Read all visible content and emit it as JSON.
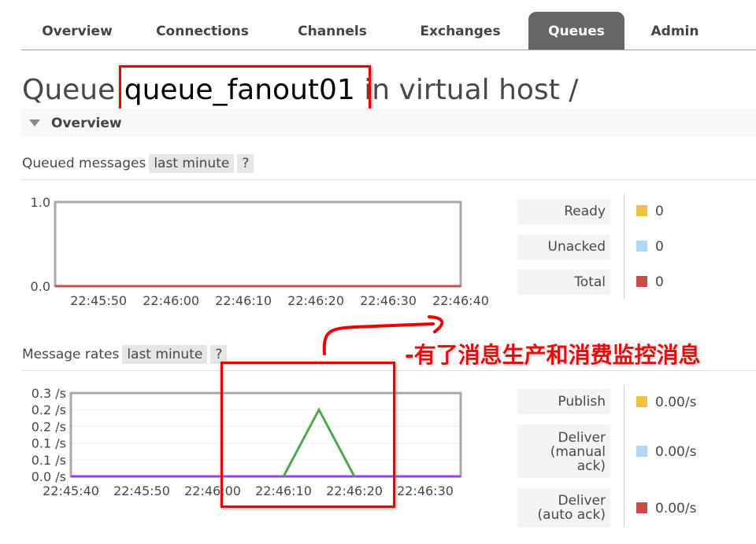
{
  "tabs": [
    {
      "label": "Overview"
    },
    {
      "label": "Connections"
    },
    {
      "label": "Channels"
    },
    {
      "label": "Exchanges"
    },
    {
      "label": "Queues",
      "active": true
    },
    {
      "label": "Admin"
    }
  ],
  "title": {
    "prefix": "Queue",
    "name": "queue_fanout01",
    "suffix": "in virtual host /"
  },
  "section": "Overview",
  "queued": {
    "label": "Queued messages",
    "range": "last minute",
    "help": "?",
    "legend": [
      {
        "label": "Ready",
        "value": "0",
        "color": "#edc240"
      },
      {
        "label": "Unacked",
        "value": "0",
        "color": "#afd8f8"
      },
      {
        "label": "Total",
        "value": "0",
        "color": "#cb4b4b"
      }
    ]
  },
  "rates": {
    "label": "Message rates",
    "range": "last minute",
    "help": "?",
    "legend": [
      {
        "label": "Publish",
        "value": "0.00/s",
        "color": "#edc240"
      },
      {
        "label": "Deliver (manual ack)",
        "value": "0.00/s",
        "color": "#afd8f8"
      },
      {
        "label": "Deliver (auto ack)",
        "value": "0.00/s",
        "color": "#cb4b4b"
      }
    ]
  },
  "annotation": "-有了消息生产和消费监控消息",
  "colors": {
    "annotation": "#e01010",
    "green": "#4da74d",
    "purple": "#9440ed"
  },
  "chart_data": [
    {
      "type": "line",
      "title": "Queued messages",
      "xlim": [
        "22:45:44",
        "22:46:40"
      ],
      "ylim": [
        0,
        1
      ],
      "xticks": [
        "22:45:50",
        "22:46:00",
        "22:46:10",
        "22:46:20",
        "22:46:30",
        "22:46:40"
      ],
      "yticks": [
        "0.0",
        "1.0"
      ],
      "ytick_values": [
        0,
        1
      ],
      "series": [
        {
          "color": "#cb4b4b",
          "x": [
            "22:45:44",
            "22:46:40"
          ],
          "y": [
            0,
            0
          ]
        }
      ]
    },
    {
      "type": "line",
      "title": "Message rates",
      "xlim": [
        "22:45:40",
        "22:46:35"
      ],
      "ylim": [
        0,
        0.25
      ],
      "xticks": [
        "22:45:40",
        "22:45:50",
        "22:46:00",
        "22:46:10",
        "22:46:20",
        "22:46:30"
      ],
      "yticks": [
        "0.0 /s",
        "0.1 /s",
        "0.1 /s",
        "0.2 /s",
        "0.2 /s",
        "0.3 /s"
      ],
      "ytick_values": [
        0,
        0.05,
        0.1,
        0.15,
        0.2,
        0.25
      ],
      "series": [
        {
          "color": "#9440ed",
          "x": [
            "22:45:40",
            "22:46:35"
          ],
          "y": [
            0,
            0
          ]
        },
        {
          "color": "#4da74d",
          "x": [
            "22:46:10",
            "22:46:15",
            "22:46:20"
          ],
          "y": [
            0,
            0.2,
            0
          ]
        }
      ]
    }
  ]
}
